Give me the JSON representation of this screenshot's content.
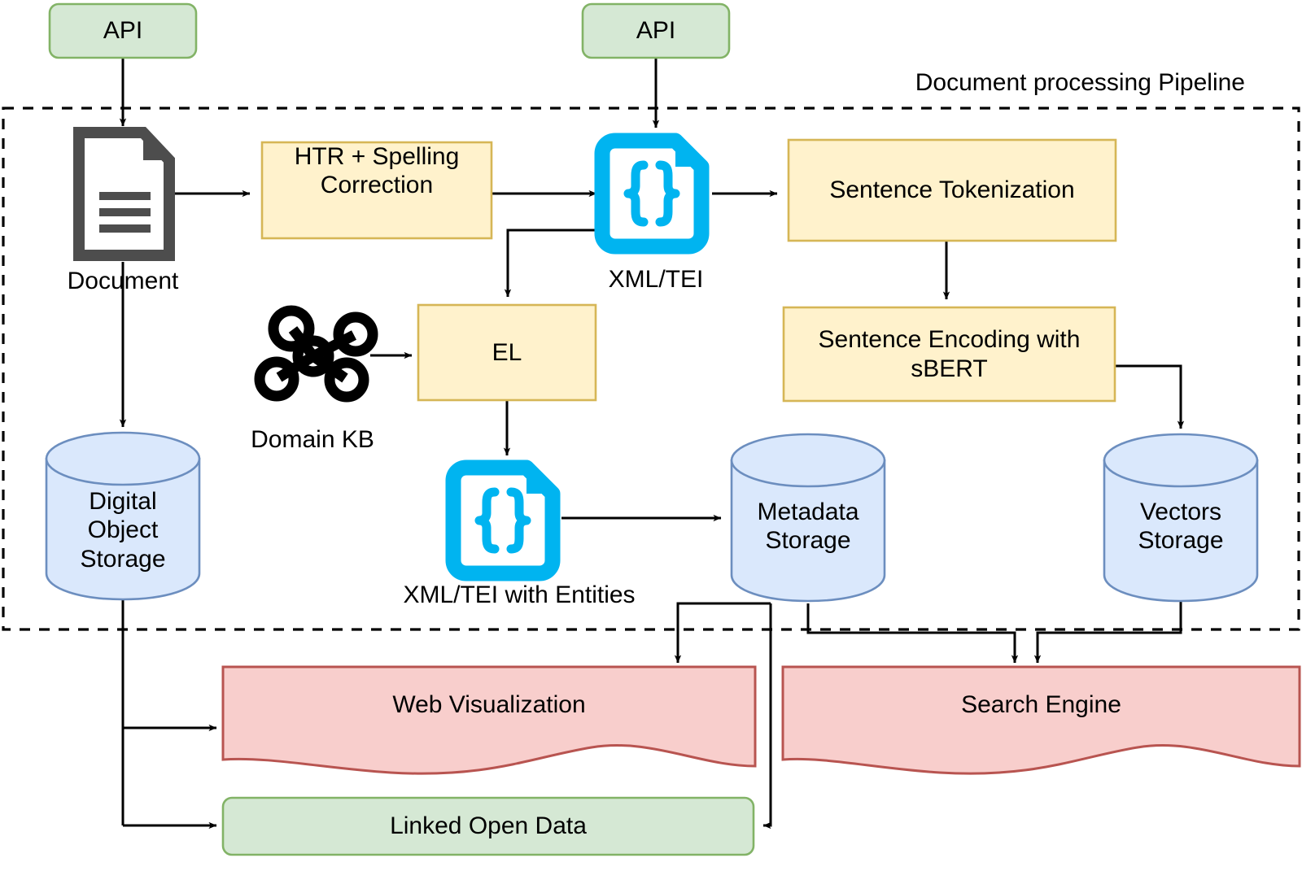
{
  "diagram": {
    "title": "Document processing Pipeline",
    "colors": {
      "green_fill": "#d5e8d4",
      "green_stroke": "#82b366",
      "yellow_fill": "#fff2cc",
      "yellow_stroke": "#d6b656",
      "blue_fill": "#dae8fc",
      "blue_stroke": "#6c8ebf",
      "red_fill": "#f8cecc",
      "red_stroke": "#b85450",
      "cyan_icon": "#00b4f0",
      "doc_icon_gray": "#4d4d4d",
      "edge_stroke": "#000000",
      "boundary_stroke": "#000000",
      "text": "#000000"
    },
    "boundary": {
      "label": "Document processing Pipeline",
      "style": "dashed"
    },
    "nodes": {
      "api_left": {
        "label": "API",
        "shape": "rounded-rect",
        "color": "green"
      },
      "api_right": {
        "label": "API",
        "shape": "rounded-rect",
        "color": "green"
      },
      "document": {
        "label": "Document",
        "shape": "document-icon",
        "color": "gray"
      },
      "htr": {
        "label": "HTR + Spelling\nCorrection",
        "shape": "rect",
        "color": "yellow"
      },
      "xml_tei": {
        "label": "XML/TEI",
        "shape": "json-file-icon",
        "color": "cyan"
      },
      "sentence_tokenization": {
        "label": "Sentence Tokenization",
        "shape": "rect",
        "color": "yellow"
      },
      "domain_kb": {
        "label": "Domain KB",
        "shape": "graph-icon",
        "color": "black"
      },
      "el": {
        "label": "EL",
        "shape": "rect",
        "color": "yellow"
      },
      "sentence_encoding": {
        "label": "Sentence Encoding with\nsBERT",
        "shape": "rect",
        "color": "yellow"
      },
      "digital_object_storage": {
        "label": "Digital\nObject\nStorage",
        "shape": "cylinder",
        "color": "blue"
      },
      "xml_tei_entities": {
        "label": "XML/TEI with Entities",
        "shape": "json-file-icon",
        "color": "cyan"
      },
      "metadata_storage": {
        "label": "Metadata\nStorage",
        "shape": "cylinder",
        "color": "blue"
      },
      "vectors_storage": {
        "label": "Vectors\nStorage",
        "shape": "cylinder",
        "color": "blue"
      },
      "web_visualization": {
        "label": "Web Visualization",
        "shape": "wave-document",
        "color": "red"
      },
      "search_engine": {
        "label": "Search Engine",
        "shape": "wave-document",
        "color": "red"
      },
      "linked_open_data": {
        "label": "Linked Open Data",
        "shape": "rounded-rect",
        "color": "green"
      }
    },
    "edges": [
      {
        "from": "api_left",
        "to": "document"
      },
      {
        "from": "document",
        "to": "htr"
      },
      {
        "from": "document",
        "to": "digital_object_storage"
      },
      {
        "from": "htr",
        "to": "xml_tei"
      },
      {
        "from": "api_right",
        "to": "xml_tei"
      },
      {
        "from": "xml_tei",
        "to": "el"
      },
      {
        "from": "xml_tei",
        "to": "sentence_tokenization"
      },
      {
        "from": "domain_kb",
        "to": "el"
      },
      {
        "from": "el",
        "to": "xml_tei_entities"
      },
      {
        "from": "xml_tei_entities",
        "to": "metadata_storage"
      },
      {
        "from": "sentence_tokenization",
        "to": "sentence_encoding"
      },
      {
        "from": "sentence_encoding",
        "to": "vectors_storage"
      },
      {
        "from": "digital_object_storage",
        "to": "web_visualization"
      },
      {
        "from": "digital_object_storage",
        "to": "linked_open_data"
      },
      {
        "from": "metadata_storage",
        "to": "web_visualization"
      },
      {
        "from": "metadata_storage",
        "to": "linked_open_data"
      },
      {
        "from": "metadata_storage",
        "to": "search_engine"
      },
      {
        "from": "vectors_storage",
        "to": "search_engine"
      }
    ]
  }
}
